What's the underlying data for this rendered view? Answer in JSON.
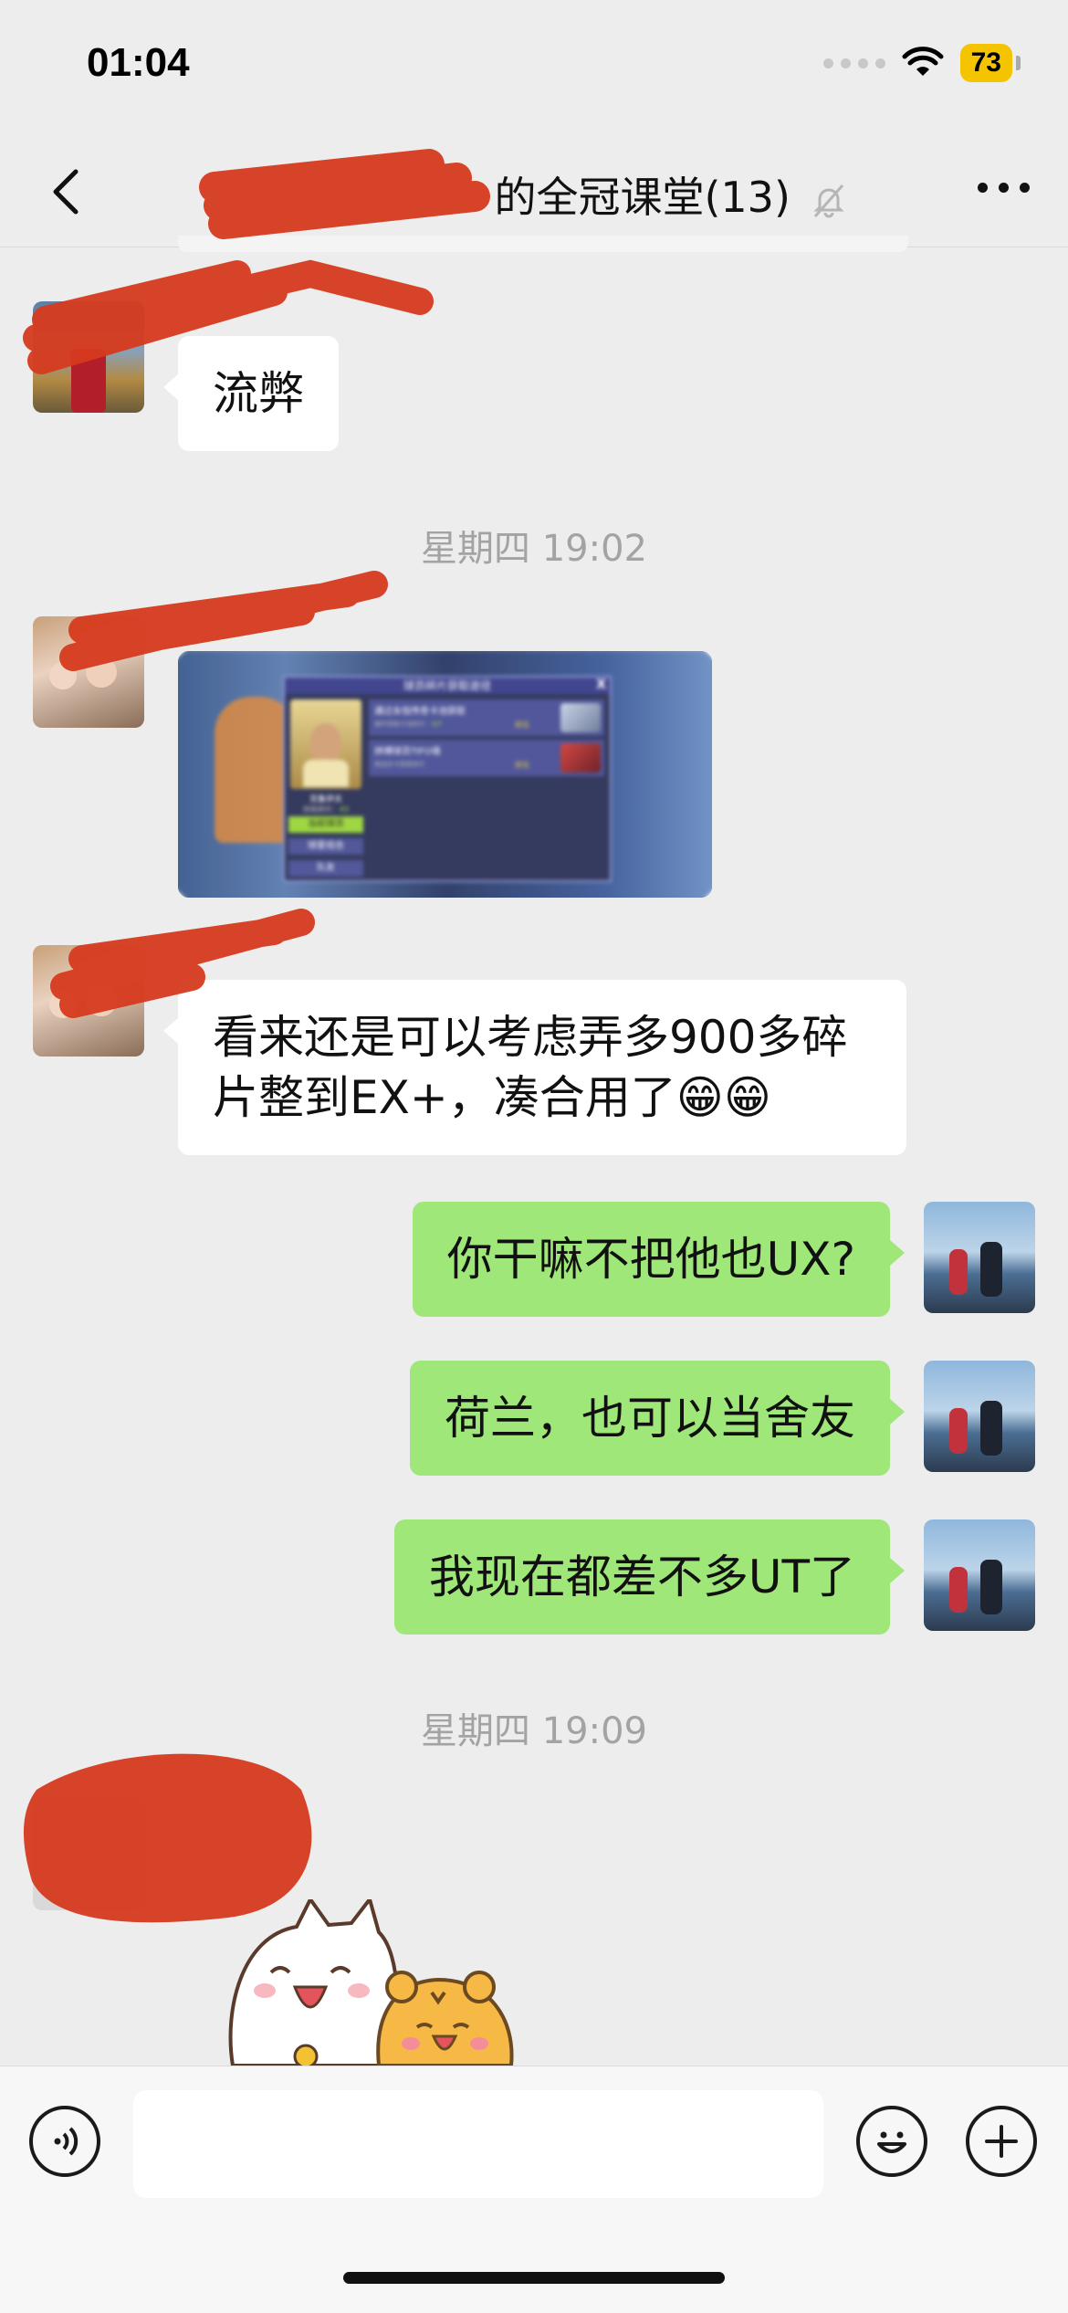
{
  "status_bar": {
    "time": "01:04",
    "battery": "73"
  },
  "header": {
    "title": "的全冠课堂(13)",
    "back_label": "back",
    "more_label": "more",
    "muted": true
  },
  "messages": [
    {
      "id": "m1",
      "dir": "in",
      "type": "text",
      "text": "流弊"
    },
    {
      "id": "t1",
      "type": "time",
      "text": "星期四 19:02"
    },
    {
      "id": "m2",
      "dir": "in",
      "type": "image",
      "image": {
        "header": "球员碎片获取途径",
        "close": "X",
        "card_name": "克鲁伊夫",
        "fragments_label": "持有碎片：",
        "fragments_value": "43",
        "tabs": [
          "当前球员",
          "球星组合",
          "队友"
        ],
        "ways": [
          {
            "title": "通过永恒传奇卡池获取",
            "desc": "循环获取卡池碎片：",
            "desc_value": "0/7",
            "action": "前往"
          },
          {
            "title": "拼搏球员TIFO墙",
            "desc": "挑战关卡获取碎片",
            "action": "前往"
          }
        ]
      }
    },
    {
      "id": "m3",
      "dir": "in",
      "type": "text",
      "text_lines": [
        "看来还是可以考虑弄多900多碎",
        "片整到EX+，凑合用了😁😁"
      ]
    },
    {
      "id": "m4",
      "dir": "out",
      "type": "text",
      "text": "你干嘛不把他也UX?"
    },
    {
      "id": "m5",
      "dir": "out",
      "type": "text",
      "text": "荷兰，也可以当舍友"
    },
    {
      "id": "m6",
      "dir": "out",
      "type": "text",
      "text": "我现在都差不多UT了"
    },
    {
      "id": "t2",
      "type": "time",
      "text": "星期四 19:09"
    },
    {
      "id": "m7",
      "dir": "in",
      "type": "sticker",
      "sticker": "cat-and-tiger-sticker"
    }
  ],
  "input_bar": {
    "placeholder": ""
  },
  "colors": {
    "background": "#ededed",
    "bubble_out": "#a0e77a",
    "bubble_in": "#ffffff",
    "redaction": "#d63a1e"
  }
}
